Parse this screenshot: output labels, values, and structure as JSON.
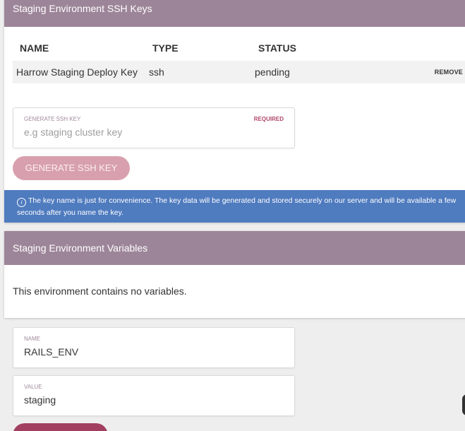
{
  "ssh_keys": {
    "title": "Staging Environment SSH Keys",
    "columns": [
      "NAME",
      "TYPE",
      "STATUS"
    ],
    "rows": [
      {
        "name": "Harrow Staging Deploy Key",
        "type": "ssh",
        "status": "pending",
        "action": "REMOVE"
      }
    ],
    "generate_field": {
      "label": "GENERATE SSH KEY",
      "required": "REQUIRED",
      "placeholder": "e.g staging cluster key",
      "value": ""
    },
    "generate_button": "GENERATE SSH KEY",
    "info": "The key name is just for convenience. The key data will be generated and stored securely on our server and will be available a few seconds after you name the key.",
    "info_icon": "info-circle-icon"
  },
  "variables": {
    "title": "Staging Environment Variables",
    "empty_text": "This environment contains no variables.",
    "name_field": {
      "label": "NAME",
      "value": "RAILS_ENV"
    },
    "value_field": {
      "label": "VALUE",
      "value": "staging"
    }
  },
  "colors": {
    "header": "#9d8599",
    "accent": "#a23f61",
    "button_disabled": "#d8a0ae",
    "info": "#4f7bbf"
  }
}
